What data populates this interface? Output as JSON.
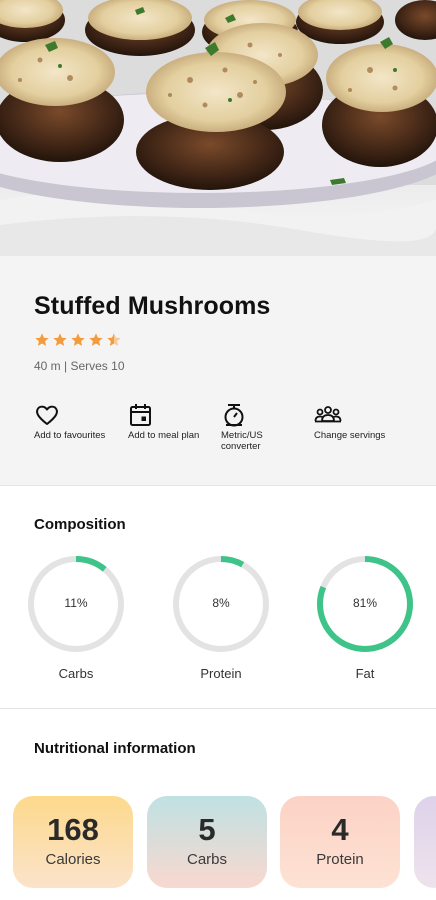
{
  "recipe": {
    "title": "Stuffed Mushrooms",
    "rating": 4.5,
    "max_rating": 5,
    "meta": "40 m | Serves 10",
    "hero_image": "stuffed-mushrooms-photo"
  },
  "actions": [
    {
      "label": "Add to favourites",
      "icon": "heart-icon"
    },
    {
      "label": "Add to meal plan",
      "icon": "calendar-icon"
    },
    {
      "label": "Metric/US converter",
      "icon": "scale-icon"
    },
    {
      "label": "Change servings",
      "icon": "people-icon"
    }
  ],
  "composition": {
    "title": "Composition",
    "items": [
      {
        "label": "Carbs",
        "percent_text": "11%",
        "percent": 11
      },
      {
        "label": "Protein",
        "percent_text": "8%",
        "percent": 8
      },
      {
        "label": "Fat",
        "percent_text": "81%",
        "percent": 81
      }
    ]
  },
  "nutrition": {
    "title": "Nutritional information",
    "cards": [
      {
        "value": "168",
        "label": "Calories"
      },
      {
        "value": "5",
        "label": "Carbs"
      },
      {
        "value": "4",
        "label": "Protein"
      }
    ]
  },
  "colors": {
    "ring_fill": "#3ec488",
    "ring_track": "#e3e3e3",
    "star": "#f39b3d",
    "info_bg": "#f4f4f4"
  }
}
